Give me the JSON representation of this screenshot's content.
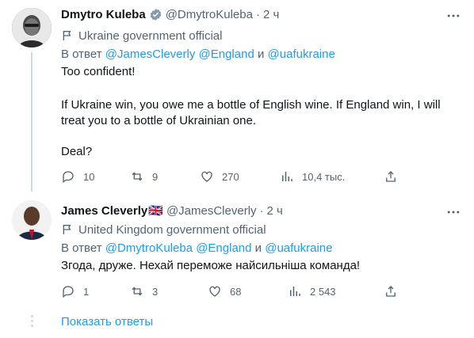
{
  "tweets": [
    {
      "name": "Dmytro Kuleba",
      "handle": "@DmytroKuleba",
      "dot": "·",
      "time": "2 ч",
      "label": "Ukraine government official",
      "reply_prefix": "В ответ",
      "mentions": [
        "@JamesCleverly",
        "@England",
        "@uafukraine"
      ],
      "conj": "и",
      "lines": [
        "Too confident!",
        "",
        "If Ukraine win, you owe me a bottle of English wine. If England win, I will",
        "treat you to a bottle of Ukrainian one.",
        "",
        "Deal?"
      ],
      "replies": "10",
      "retweets": "9",
      "likes": "270",
      "views": "10,4 тыс."
    },
    {
      "name": "James Cleverly",
      "flag": "🇬🇧",
      "handle": "@JamesCleverly",
      "dot": "·",
      "time": "2 ч",
      "label": "United Kingdom government official",
      "reply_prefix": "В ответ",
      "mentions": [
        "@DmytroKuleba",
        "@England",
        "@uafukraine"
      ],
      "conj": "и",
      "lines": [
        "Згода, друже. Нехай переможе найсильніша команда!"
      ],
      "replies": "1",
      "retweets": "3",
      "likes": "68",
      "views": "2 543"
    }
  ],
  "show_replies": "Показать ответы",
  "colors": {
    "link": "#1d9bf0",
    "muted": "#536471",
    "verified": "#829aab",
    "line": "#cfd9de"
  },
  "icons": [
    "more-icon",
    "flag-icon",
    "verified-icon",
    "reply-icon",
    "retweet-icon",
    "like-icon",
    "views-icon",
    "share-icon"
  ]
}
